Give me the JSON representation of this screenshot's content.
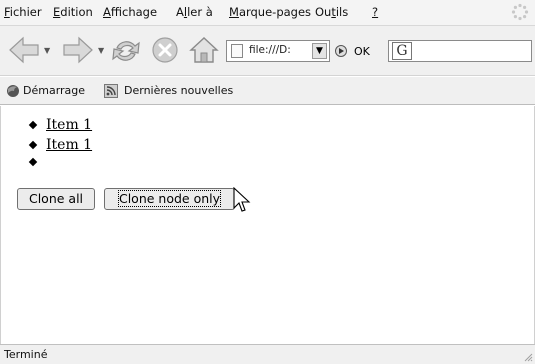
{
  "menubar": {
    "items": [
      {
        "label": "Fichier",
        "accel": "F",
        "rest": "ichier"
      },
      {
        "label": "Edition",
        "accel": "E",
        "rest": "dition"
      },
      {
        "label": "Affichage",
        "accel": "A",
        "rest": "ffichage"
      },
      {
        "label": "Aller à",
        "pre": "A",
        "accel": "l",
        "rest": "ler à"
      },
      {
        "label": "Marque-pages",
        "accel": "M",
        "rest": "arque-pages"
      },
      {
        "label": "Outils",
        "pre": "Ou",
        "accel": "t",
        "rest": "ils"
      },
      {
        "label": "?",
        "accel": "?",
        "rest": ""
      }
    ]
  },
  "navbar": {
    "url": "file:///D:",
    "go_label": "OK",
    "search_engine": "G"
  },
  "bookmarks": {
    "items": [
      {
        "label": "Démarrage",
        "icon": "firefox-icon"
      },
      {
        "label": "Dernières nouvelles",
        "icon": "rss-icon"
      }
    ]
  },
  "content": {
    "list": [
      "Item 1",
      "Item 1",
      ""
    ],
    "buttons": {
      "clone_all": "Clone all",
      "clone_node_only": "Clone node only"
    }
  },
  "statusbar": {
    "text": "Terminé"
  },
  "colors": {
    "chrome": "#f0f0f0",
    "page": "#ffffff",
    "button": "#ececec"
  }
}
